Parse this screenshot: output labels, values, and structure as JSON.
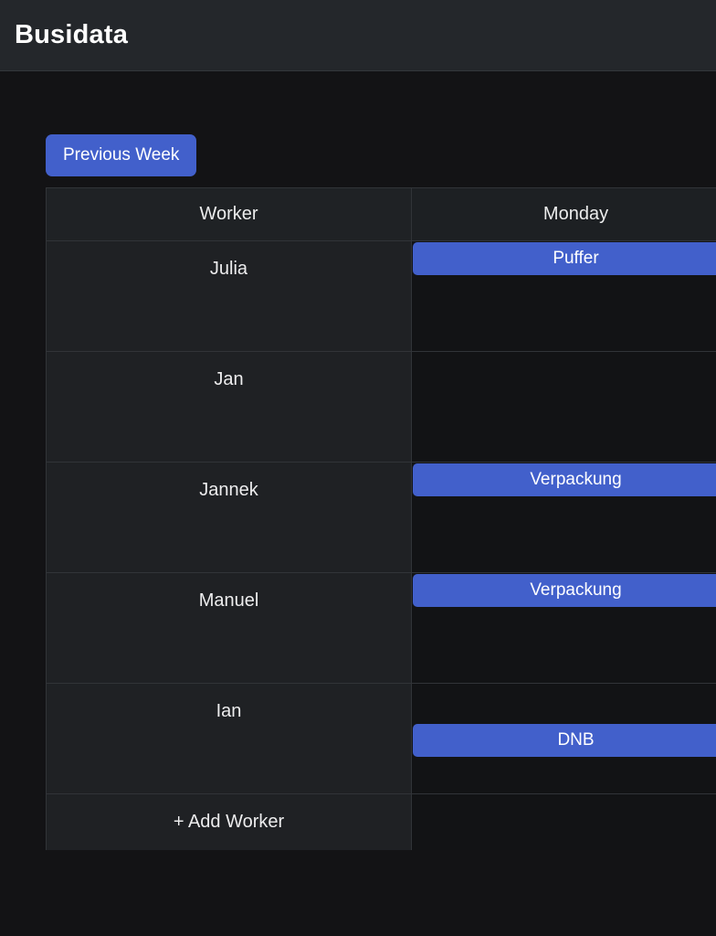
{
  "app": {
    "title": "Busidata",
    "theme": {
      "page_background": "#131315",
      "appbar_background": "#24272b",
      "accent": "#4260cb",
      "worker_cell_background": "#1f2124",
      "day_cell_background": "#121315",
      "border": "#313438",
      "text": "#ededee"
    }
  },
  "toolbar": {
    "previous_week_label": "Previous Week"
  },
  "schedule": {
    "columns": [
      {
        "key": "worker",
        "label": "Worker"
      },
      {
        "key": "monday",
        "label": "Monday"
      }
    ],
    "rows": [
      {
        "worker": "Julia",
        "shifts": [
          {
            "label": "Puffer",
            "slot": "top"
          }
        ]
      },
      {
        "worker": "Jan",
        "shifts": []
      },
      {
        "worker": "Jannek",
        "shifts": [
          {
            "label": "Verpackung",
            "slot": "top"
          }
        ]
      },
      {
        "worker": "Manuel",
        "shifts": [
          {
            "label": "Verpackung",
            "slot": "top"
          }
        ]
      },
      {
        "worker": "Ian",
        "shifts": [
          {
            "label": "DNB",
            "slot": "mid"
          }
        ]
      }
    ],
    "add_worker_label": "+ Add Worker"
  }
}
